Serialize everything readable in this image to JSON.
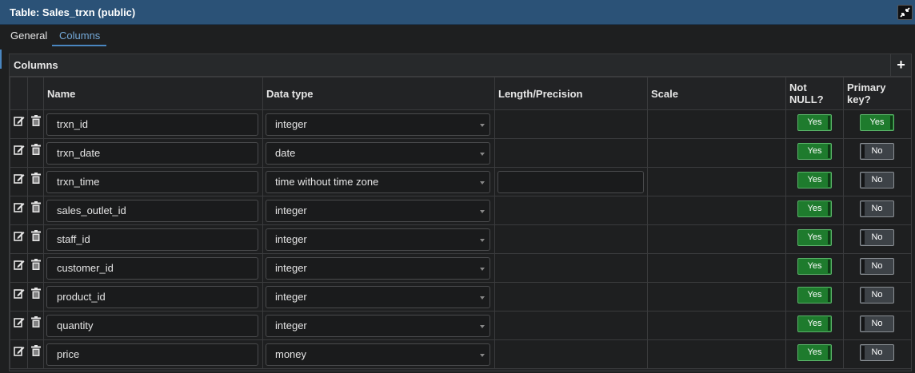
{
  "window": {
    "title": "Table: Sales_trxn (public)"
  },
  "tabs": [
    {
      "label": "General"
    },
    {
      "label": "Columns"
    }
  ],
  "columns_panel": {
    "label": "Columns",
    "add_label": "+",
    "headers": {
      "name": "Name",
      "data_type": "Data type",
      "length": "Length/Precision",
      "scale": "Scale",
      "not_null": "Not NULL?",
      "primary_key": "Primary key?"
    },
    "rows": [
      {
        "name": "trxn_id",
        "data_type": "integer",
        "not_null": "Yes",
        "primary_key": "Yes"
      },
      {
        "name": "trxn_date",
        "data_type": "date",
        "not_null": "Yes",
        "primary_key": "No"
      },
      {
        "name": "trxn_time",
        "data_type": "time without time zone",
        "not_null": "Yes",
        "primary_key": "No"
      },
      {
        "name": "sales_outlet_id",
        "data_type": "integer",
        "not_null": "Yes",
        "primary_key": "No"
      },
      {
        "name": "staff_id",
        "data_type": "integer",
        "not_null": "Yes",
        "primary_key": "No"
      },
      {
        "name": "customer_id",
        "data_type": "integer",
        "not_null": "Yes",
        "primary_key": "No"
      },
      {
        "name": "product_id",
        "data_type": "integer",
        "not_null": "Yes",
        "primary_key": "No"
      },
      {
        "name": "quantity",
        "data_type": "integer",
        "not_null": "Yes",
        "primary_key": "No"
      },
      {
        "name": "price",
        "data_type": "money",
        "not_null": "Yes",
        "primary_key": "No"
      }
    ]
  },
  "colors": {
    "titlebar": "#2b5277",
    "accent": "#4a86c0",
    "toggle_yes": "#1e7b2d",
    "toggle_no": "#3d4247"
  }
}
